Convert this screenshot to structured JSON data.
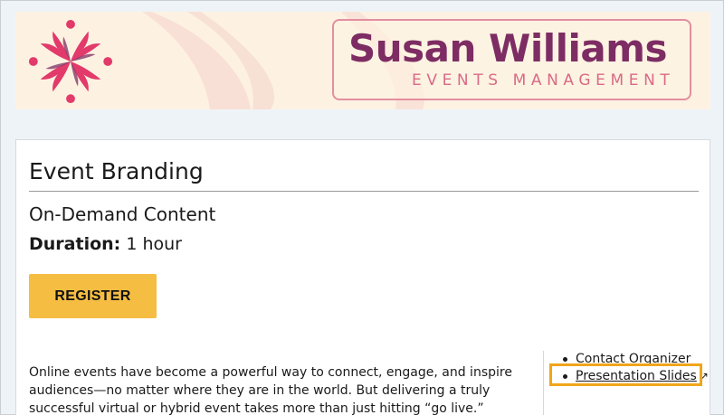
{
  "banner": {
    "brand_name": "Susan Williams",
    "tagline": "EVENTS MANAGEMENT",
    "logo_icon": "flower-logo-icon",
    "colors": {
      "brand": "#7d2d63",
      "accent": "#d96a86",
      "background": "#fdf2e2"
    }
  },
  "event": {
    "title": "Event Branding",
    "content_type": "On-Demand Content",
    "duration_label": "Duration:",
    "duration_value": "1 hour",
    "register_label": "REGISTER",
    "description": "Online events have become a powerful way to connect, engage, and inspire audiences—no matter where they are in the world. But delivering a truly successful virtual or hybrid event takes more than just hitting “go live.”"
  },
  "links": {
    "contact": "Contact Organizer",
    "slides": "Presentation Slides",
    "external_icon": "↗"
  },
  "colors": {
    "register_button": "#f5bd42",
    "highlight": "#f1a51b"
  }
}
